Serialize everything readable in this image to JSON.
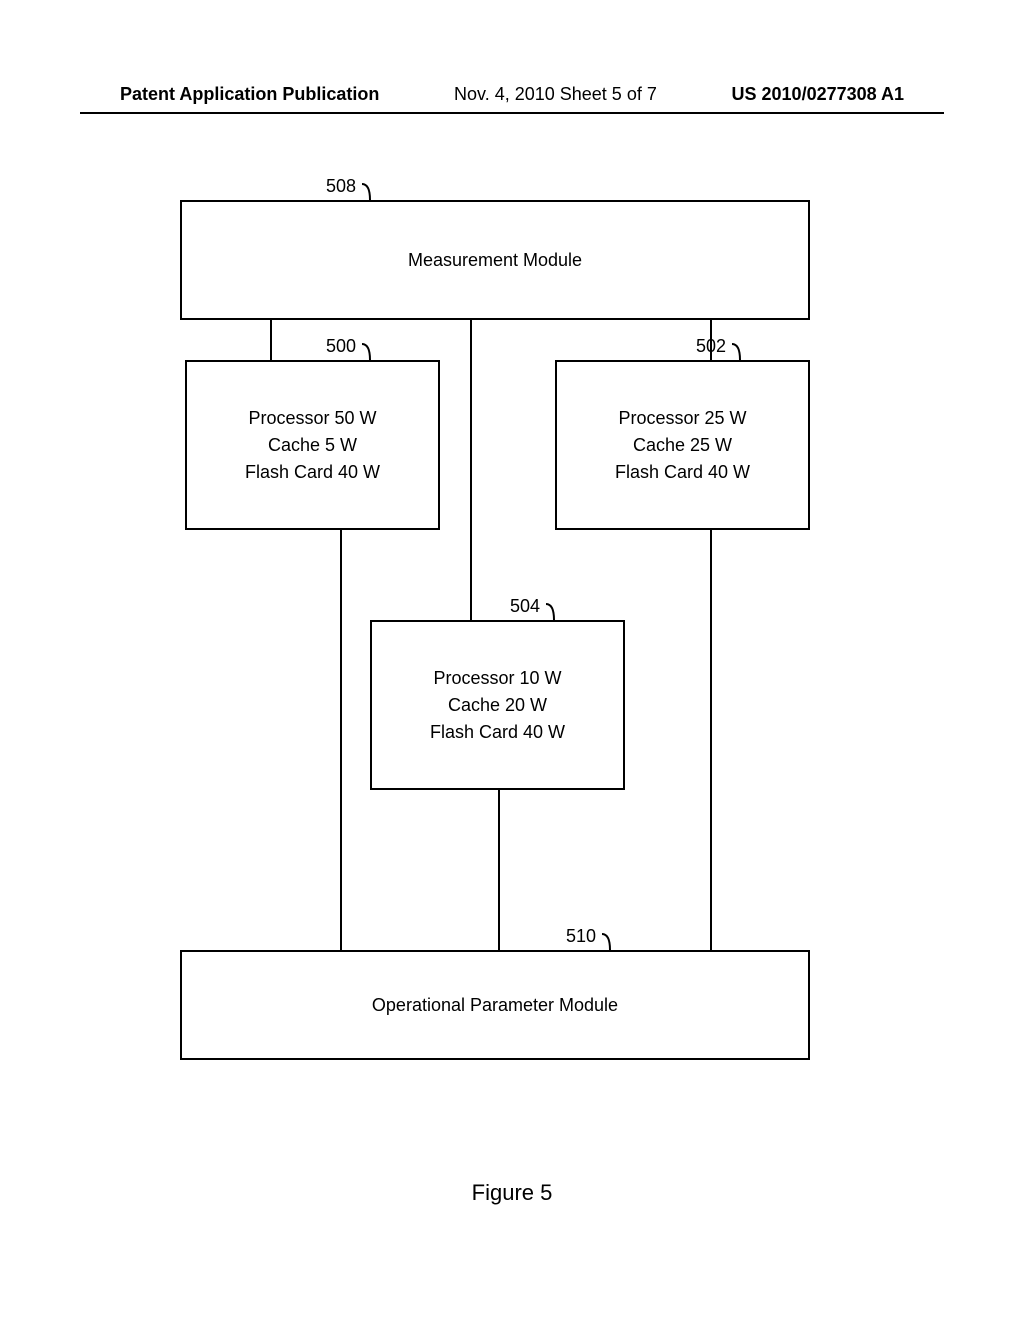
{
  "header": {
    "left": "Patent Application Publication",
    "mid": "Nov. 4, 2010  Sheet 5 of 7",
    "right": "US 2010/0277308 A1"
  },
  "labels": {
    "ref508": "508",
    "ref500": "500",
    "ref502": "502",
    "ref504": "504",
    "ref510": "510"
  },
  "boxes": {
    "measurement": "Measurement Module",
    "b500": {
      "l1": "Processor  50 W",
      "l2": "Cache  5 W",
      "l3": "Flash Card  40 W"
    },
    "b502": {
      "l1": "Processor  25 W",
      "l2": "Cache  25 W",
      "l3": "Flash Card  40 W"
    },
    "b504": {
      "l1": "Processor  10 W",
      "l2": "Cache  20 W",
      "l3": "Flash Card  40 W"
    },
    "opmod": "Operational Parameter Module"
  },
  "figure_caption": "Figure 5"
}
